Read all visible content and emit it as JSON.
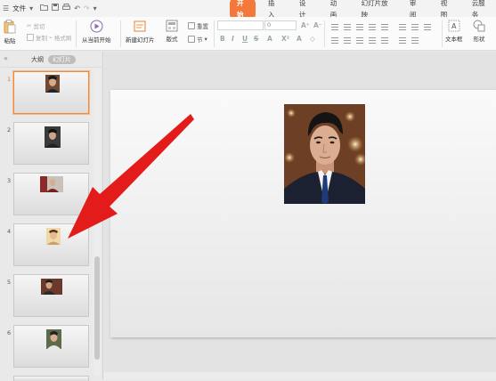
{
  "menu": {
    "file_label": "文件",
    "tabs": [
      {
        "label": "开始",
        "active": true
      },
      {
        "label": "插入"
      },
      {
        "label": "设计"
      },
      {
        "label": "动画"
      },
      {
        "label": "幻灯片放映"
      },
      {
        "label": "审阅"
      },
      {
        "label": "视图"
      },
      {
        "label": "云服务"
      }
    ]
  },
  "ribbon": {
    "paste": "粘贴",
    "cut": "剪切",
    "copy": "复制",
    "format_painter": "格式刷",
    "play_from_current": "从当前开始",
    "new_slide": "新建幻灯片",
    "layout": "版式",
    "reset": "重置",
    "section": "节",
    "font_size_value": "0",
    "bold": "B",
    "italic": "I",
    "underline": "U",
    "strike": "S",
    "textbox": "文本框",
    "shape": "形状"
  },
  "panel": {
    "outline_tab": "大纲",
    "slides_tab": "幻灯片",
    "slides": [
      {
        "num": "1",
        "selected": true
      },
      {
        "num": "2"
      },
      {
        "num": "3"
      },
      {
        "num": "4"
      },
      {
        "num": "5"
      },
      {
        "num": "6"
      }
    ]
  },
  "colors": {
    "accent": "#f2793a",
    "arrow": "#e31b1b"
  }
}
